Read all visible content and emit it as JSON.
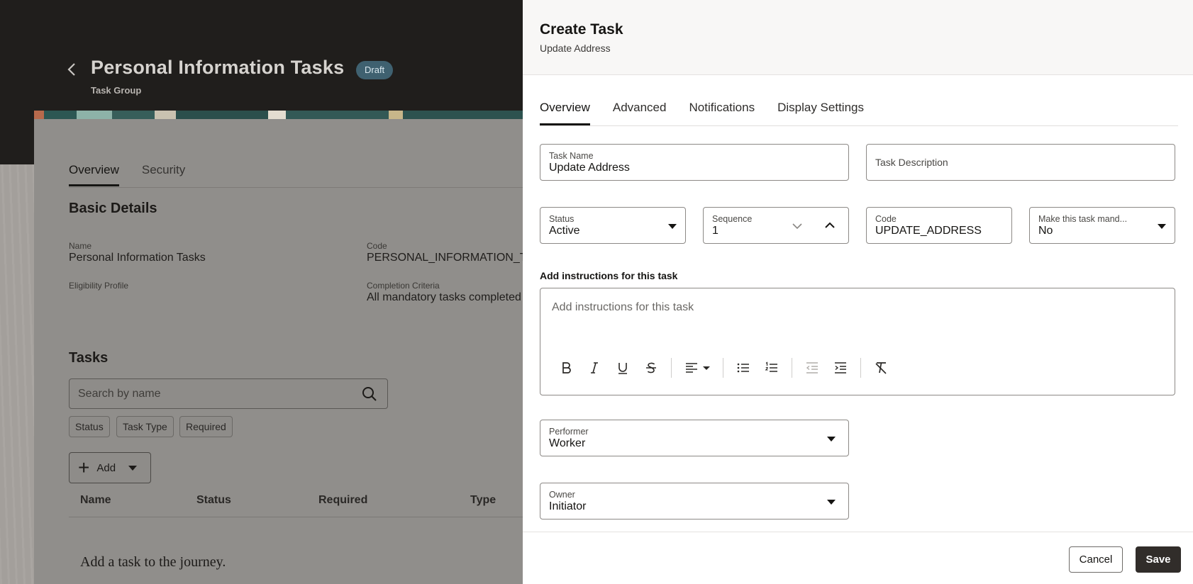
{
  "background": {
    "title": "Personal Information Tasks",
    "badge": "Draft",
    "subtitle": "Task Group",
    "tabs": [
      "Overview",
      "Security"
    ],
    "basic_details": {
      "heading": "Basic Details",
      "name_label": "Name",
      "name_value": "Personal Information Tasks",
      "code_label": "Code",
      "code_value": "PERSONAL_INFORMATION_TA",
      "eligibility_label": "Eligibility Profile",
      "completion_label": "Completion Criteria",
      "completion_value": "All mandatory tasks completed"
    },
    "tasks": {
      "heading": "Tasks",
      "search_placeholder": "Search by name",
      "filters": [
        "Status",
        "Task Type",
        "Required"
      ],
      "add_label": "Add",
      "columns": [
        "Name",
        "Status",
        "Required",
        "Type"
      ],
      "empty_message": "Add a task to the journey."
    }
  },
  "drawer": {
    "title": "Create Task",
    "subtitle": "Update Address",
    "tabs": [
      "Overview",
      "Advanced",
      "Notifications",
      "Display Settings"
    ],
    "fields": {
      "task_name_label": "Task Name",
      "task_name_value": "Update Address",
      "task_description_placeholder": "Task Description",
      "status_label": "Status",
      "status_value": "Active",
      "sequence_label": "Sequence",
      "sequence_value": "1",
      "code_label": "Code",
      "code_value": "UPDATE_ADDRESS",
      "mandatory_label": "Make this task mand...",
      "mandatory_value": "No",
      "instructions_label": "Add instructions for this task",
      "instructions_placeholder": "Add instructions for this task",
      "performer_label": "Performer",
      "performer_value": "Worker",
      "owner_label": "Owner",
      "owner_value": "Initiator"
    },
    "footer": {
      "cancel_label": "Cancel",
      "save_label": "Save"
    }
  }
}
